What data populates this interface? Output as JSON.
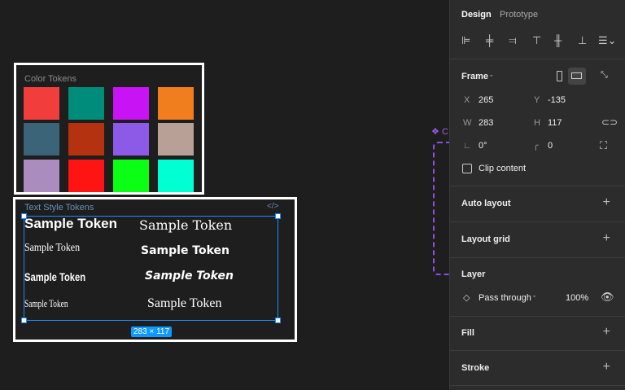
{
  "canvas": {
    "color_frame": {
      "title": "Color Tokens",
      "swatches": [
        "#f23d3d",
        "#008c7a",
        "#c814f5",
        "#f07d1e",
        "#3c6478",
        "#b43210",
        "#8c5ae6",
        "#b9a096",
        "#aa8cbe",
        "#ff1414",
        "#0aff14",
        "#00ffd2"
      ]
    },
    "text_frame": {
      "title": "Text Style Tokens",
      "code_icon": "code-icon",
      "samples": [
        "Sample Token",
        "Sample Token",
        "Sample Token",
        "Sample Token",
        "Sample Token",
        "Sample Token",
        "Sample Token",
        "Sample Token"
      ],
      "size_badge": "283 × 117"
    },
    "component_label": "C"
  },
  "panel": {
    "tabs": [
      "Design",
      "Prototype"
    ],
    "frame": {
      "label": "Frame",
      "x_label": "X",
      "x": "265",
      "y_label": "Y",
      "y": "-135",
      "w_label": "W",
      "w": "283",
      "h_label": "H",
      "h": "117",
      "rotation": "0°",
      "radius": "0",
      "clip_label": "Clip content"
    },
    "sections": {
      "auto_layout": "Auto layout",
      "layout_grid": "Layout grid",
      "layer": "Layer",
      "fill": "Fill",
      "stroke": "Stroke"
    },
    "layer": {
      "blend": "Pass through",
      "opacity": "100%"
    },
    "accent": "#0d99ff"
  }
}
